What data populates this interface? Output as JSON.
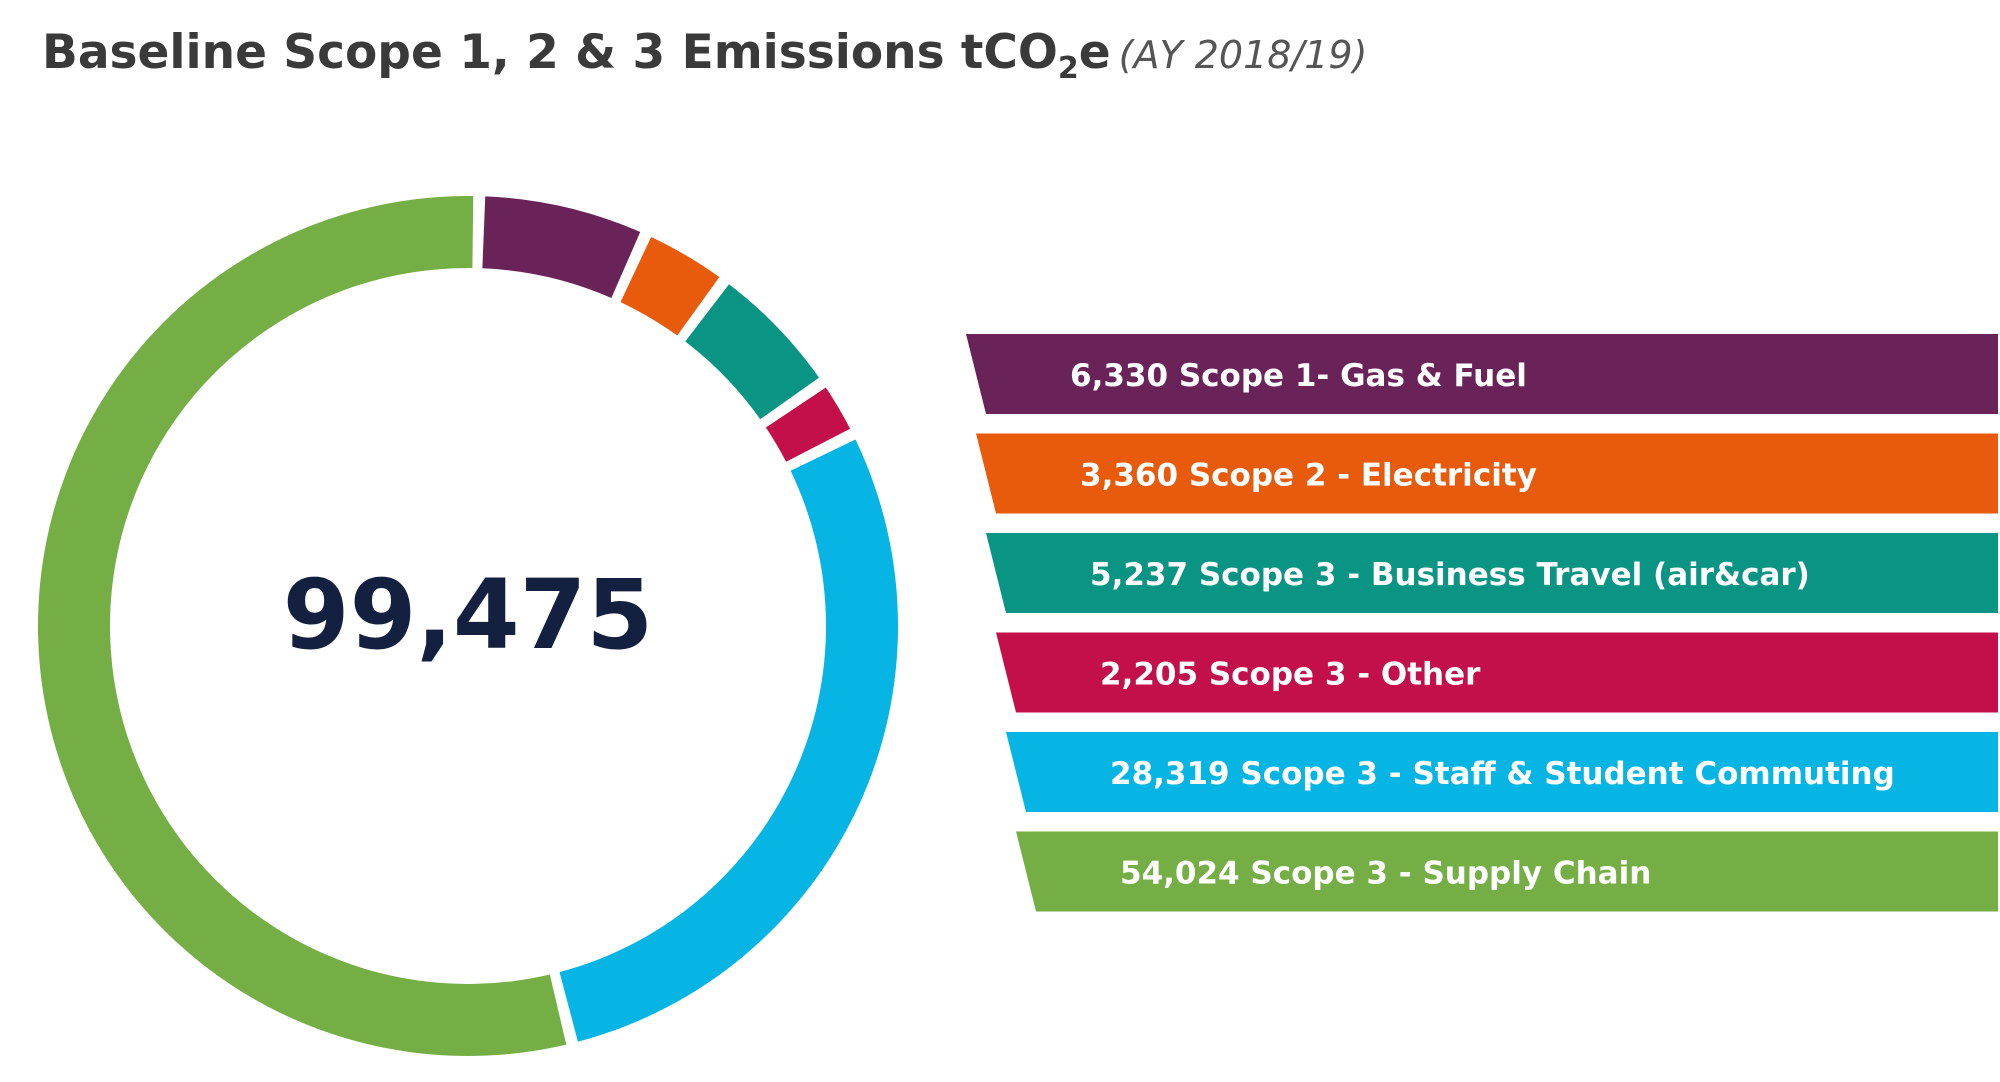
{
  "header": {
    "title_main": "Baseline Scope 1, 2 & 3 Emissions tCO",
    "title_sub": "2",
    "title_end": "e",
    "title_period": "(AY 2018/19)"
  },
  "chart_data": {
    "type": "pie",
    "variant": "donut",
    "total_label": "99,475",
    "slices": [
      {
        "label": "6,330 Scope 1- Gas & Fuel",
        "value": 6330,
        "color": "#6a2358"
      },
      {
        "label": "3,360 Scope 2 - Electricity",
        "value": 3360,
        "color": "#e85a0c"
      },
      {
        "label": "5,237 Scope 3 - Business Travel (air&car)",
        "value": 5237,
        "color": "#0a9484"
      },
      {
        "label": "2,205 Scope 3 - Other",
        "value": 2205,
        "color": "#c3104a"
      },
      {
        "label": "28,319 Scope 3 - Staff & Student Commuting",
        "value": 28319,
        "color": "#06b5e4"
      },
      {
        "label": "54,024 Scope 3 - Supply Chain",
        "value": 54024,
        "color": "#74ae45"
      }
    ],
    "legend_position": "right"
  }
}
